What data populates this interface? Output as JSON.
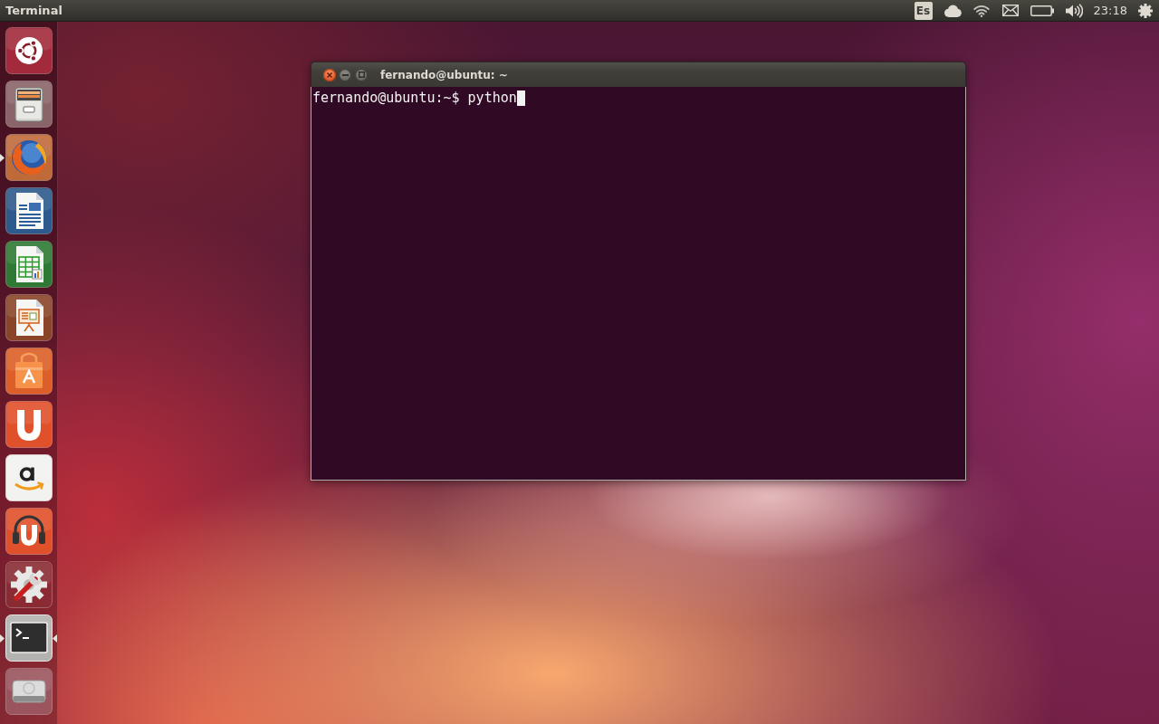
{
  "top_panel": {
    "app_title": "Terminal",
    "indicators": [
      {
        "kind": "keyboard",
        "label": "Es"
      },
      {
        "kind": "cloud"
      },
      {
        "kind": "network"
      },
      {
        "kind": "messages"
      },
      {
        "kind": "battery"
      },
      {
        "kind": "sound"
      },
      {
        "kind": "clock",
        "label": "23:18"
      },
      {
        "kind": "session"
      }
    ]
  },
  "launcher": [
    {
      "kind": "dash",
      "running": false,
      "focused": false
    },
    {
      "kind": "files",
      "running": false,
      "focused": false
    },
    {
      "kind": "browser",
      "running": true,
      "focused": false
    },
    {
      "kind": "writer",
      "running": false,
      "focused": false
    },
    {
      "kind": "calc",
      "running": false,
      "focused": false
    },
    {
      "kind": "impress",
      "running": false,
      "focused": false
    },
    {
      "kind": "software",
      "running": false,
      "focused": false
    },
    {
      "kind": "cloud",
      "running": false,
      "focused": false
    },
    {
      "kind": "store",
      "running": false,
      "focused": false
    },
    {
      "kind": "music",
      "running": false,
      "focused": false
    },
    {
      "kind": "settings",
      "running": false,
      "focused": false
    },
    {
      "kind": "terminal",
      "running": true,
      "focused": true
    },
    {
      "kind": "drive",
      "running": false,
      "focused": false
    }
  ],
  "window": {
    "title": "fernando@ubuntu: ~",
    "lines": [
      {
        "text": "fernando@ubuntu:~$ python",
        "cursor": true
      }
    ]
  }
}
